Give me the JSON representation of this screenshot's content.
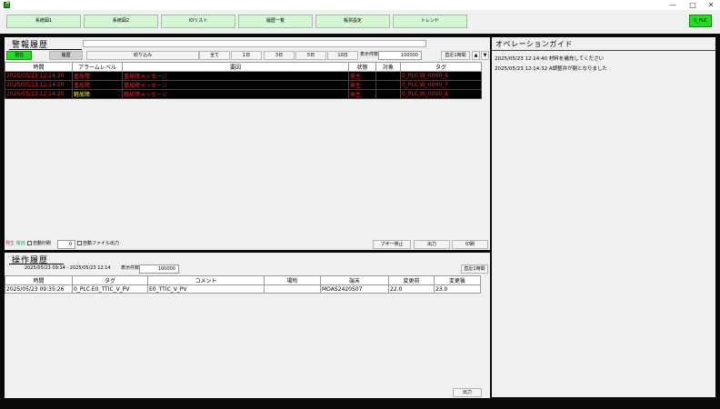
{
  "window": {
    "controls": [
      "—",
      "□",
      "✕"
    ]
  },
  "nav": {
    "buttons": [
      "系統図1",
      "系統図2",
      "IOリスト",
      "履歴一覧",
      "帳票設定",
      "トレンド"
    ],
    "plc_label": "0_PLC"
  },
  "alarm": {
    "title": "警報履歴",
    "toggle_current": "現在",
    "toggle_history": "履歴",
    "filter_label": "絞り込み",
    "range_buttons": [
      "全て",
      "1日",
      "3日",
      "5日",
      "10日"
    ],
    "display_count_label": "表示件数",
    "display_count_value": "100000",
    "recent_button": "直近1時間",
    "columns": [
      "時間",
      "アラームレベル",
      "要因",
      "状態",
      "対象",
      "タグ"
    ],
    "rows": [
      {
        "time": "2025/05/23 12:14:20",
        "level": "重故障",
        "cause": "重故障メッセージ",
        "state": "発生",
        "target": "",
        "tag": "0_PLC.W_0000_6",
        "level_color": "red",
        "cause_color": "red"
      },
      {
        "time": "2025/05/23 12:14:20",
        "level": "重故障",
        "cause": "重故障メッセージ",
        "state": "発生",
        "target": "",
        "tag": "0_PLC.W_0000_7",
        "level_color": "red",
        "cause_color": "red"
      },
      {
        "time": "2025/05/23 12:14:20",
        "level": "軽故障",
        "cause": "軽故障メッセージ",
        "state": "発生",
        "target": "",
        "tag": "0_PLC.W_0000_8",
        "level_color": "yellow",
        "cause_color": "red"
      }
    ],
    "footer": {
      "occur_label": "発生",
      "recover_label": "復旧",
      "auto_print_label": "自動印刷",
      "count_value": "0",
      "auto_file_label": "自動ファイル出力",
      "buzzer_stop": "ブザー停止",
      "output": "出力",
      "print": "印刷"
    }
  },
  "operation": {
    "title": "操作履歴",
    "range_text": "2025/05/23 09:14 - 2025/05/23 12:14",
    "display_count_label": "表示件数",
    "display_count_value": "100000",
    "recent_button": "直近1時間",
    "columns": [
      "時間",
      "タグ",
      "コメント",
      "場所",
      "端末",
      "変更前",
      "変更後"
    ],
    "rows": [
      {
        "time": "2025/05/23 09:35:26",
        "tag": "0_PLC.E0_TTIC_V_PV",
        "comment": "E0_TTIC_V_PV",
        "place": "",
        "terminal": "MOAS2420S07",
        "before": "22.0",
        "after": "23.0"
      }
    ],
    "output": "出力"
  },
  "guide": {
    "title": "オペレーションガイド",
    "lines": [
      "2025/05/23 12:14:40  材料を補充してください",
      "2025/05/23 12:14:32  A調整弁が閉となりました"
    ]
  },
  "colors": {
    "nav_button": "#d6f5d6",
    "plc_badge": "#22dd22",
    "alarm_red": "#ff2222",
    "alarm_yellow": "#ffff00",
    "current_toggle": "#22dd22"
  }
}
